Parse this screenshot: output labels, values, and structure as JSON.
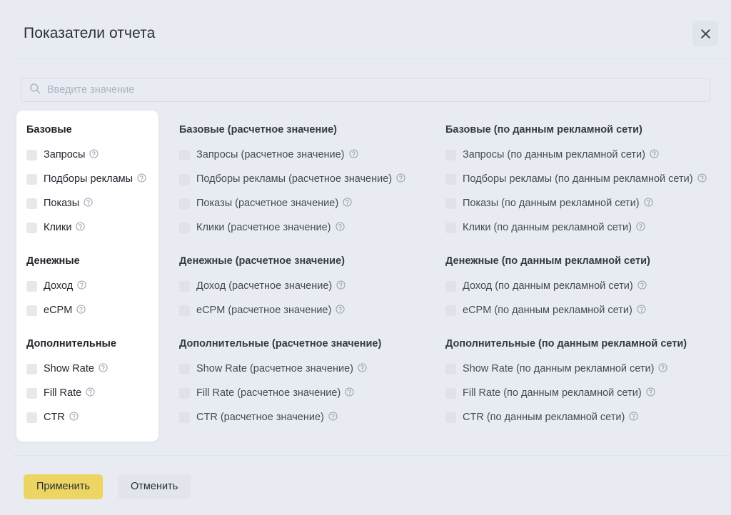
{
  "header": {
    "title": "Показатели отчета",
    "close_icon": "close-icon"
  },
  "search": {
    "placeholder": "Введите значение",
    "value": "",
    "icon": "search-icon"
  },
  "help_icon": "help-circle-icon",
  "columns": [
    {
      "id": "base",
      "groups": [
        {
          "title": "Базовые",
          "options": [
            {
              "label": "Запросы",
              "checked": false
            },
            {
              "label": "Подборы рекламы",
              "checked": false
            },
            {
              "label": "Показы",
              "checked": false
            },
            {
              "label": "Клики",
              "checked": false
            }
          ]
        },
        {
          "title": "Денежные",
          "options": [
            {
              "label": "Доход",
              "checked": false
            },
            {
              "label": "eCPM",
              "checked": false
            }
          ]
        },
        {
          "title": "Дополнительные",
          "options": [
            {
              "label": "Show Rate",
              "checked": false
            },
            {
              "label": "Fill Rate",
              "checked": false
            },
            {
              "label": "CTR",
              "checked": false
            }
          ]
        }
      ]
    },
    {
      "id": "calculated",
      "groups": [
        {
          "title": "Базовые (расчетное значение)",
          "options": [
            {
              "label": "Запросы (расчетное значение)",
              "checked": false
            },
            {
              "label": "Подборы рекламы (расчетное значение)",
              "checked": false
            },
            {
              "label": "Показы (расчетное значение)",
              "checked": false
            },
            {
              "label": "Клики (расчетное значение)",
              "checked": false
            }
          ]
        },
        {
          "title": "Денежные (расчетное значение)",
          "options": [
            {
              "label": "Доход (расчетное значение)",
              "checked": false
            },
            {
              "label": "eCPM (расчетное значение)",
              "checked": false
            }
          ]
        },
        {
          "title": "Дополнительные (расчетное значение)",
          "options": [
            {
              "label": "Show Rate (расчетное значение)",
              "checked": false
            },
            {
              "label": "Fill Rate (расчетное значение)",
              "checked": false
            },
            {
              "label": "CTR (расчетное значение)",
              "checked": false
            }
          ]
        }
      ]
    },
    {
      "id": "adnetwork",
      "groups": [
        {
          "title": "Базовые (по данным рекламной сети)",
          "options": [
            {
              "label": "Запросы (по данным рекламной сети)",
              "checked": false
            },
            {
              "label": "Подборы рекламы (по данным рекламной сети)",
              "checked": false
            },
            {
              "label": "Показы (по данным рекламной сети)",
              "checked": false
            },
            {
              "label": "Клики (по данным рекламной сети)",
              "checked": false
            }
          ]
        },
        {
          "title": "Денежные (по данным рекламной сети)",
          "options": [
            {
              "label": "Доход (по данным рекламной сети)",
              "checked": false
            },
            {
              "label": "eCPM (по данным рекламной сети)",
              "checked": false
            }
          ]
        },
        {
          "title": "Дополнительные (по данным рекламной сети)",
          "options": [
            {
              "label": "Show Rate (по данным рекламной сети)",
              "checked": false
            },
            {
              "label": "Fill Rate (по данным рекламной сети)",
              "checked": false
            },
            {
              "label": "CTR (по данным рекламной сети)",
              "checked": false
            }
          ]
        }
      ]
    }
  ],
  "footer": {
    "apply_label": "Применить",
    "cancel_label": "Отменить"
  },
  "colors": {
    "background": "#e8ebf2",
    "card": "#ffffff",
    "accent": "#ecd563",
    "secondary_button": "#e2e5ec",
    "checkbox": "#e6e8ec",
    "divider": "#dfe3eb"
  }
}
